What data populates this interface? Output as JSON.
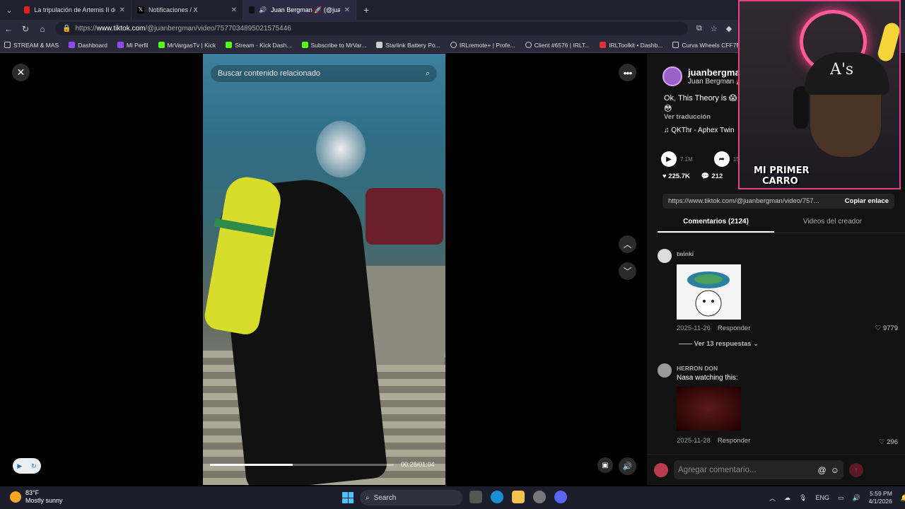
{
  "browser": {
    "tabs": [
      {
        "title": "La tripulación de Artemis II de la N",
        "color": "#e02020"
      },
      {
        "title": "Notificaciones / X",
        "color": "#ffffff"
      },
      {
        "title": "Juan Bergman 🚀 (@juanberg",
        "color": "#ffffff"
      }
    ],
    "url_prefix": "https://",
    "url_host": "www.tiktok.com",
    "url_path": "/@juanbergman/video/7577034895021575446",
    "bookmarks": [
      {
        "label": "STREAM & MAS",
        "color": "#cccccc"
      },
      {
        "label": "Dashboard",
        "color": "#9146ff"
      },
      {
        "label": "Mi Perfil",
        "color": "#9146ff"
      },
      {
        "label": "MrVargasTv | Kick",
        "color": "#53fc18"
      },
      {
        "label": "Stream - Kick Dash...",
        "color": "#53fc18"
      },
      {
        "label": "Subscribe to MrVar...",
        "color": "#53fc18"
      },
      {
        "label": "Starlink Battery Po...",
        "color": "#cccccc"
      },
      {
        "label": "IRLremote+ | Profe...",
        "color": "#cccccc"
      },
      {
        "label": "Client #6576 | IRLT...",
        "color": "#cccccc"
      },
      {
        "label": "IRLToolkit • Dashb...",
        "color": "#e0303a"
      },
      {
        "label": "Curva Wheels CFF7E",
        "color": "#cccccc"
      }
    ]
  },
  "video": {
    "search_placeholder": "Buscar contenido relacionado",
    "progress": 0.45,
    "timecode": "00:28/01:04"
  },
  "panel": {
    "author_handle": "juanbergma",
    "author_name": "Juan Bergman 🚀",
    "description": "Ok, This Theory is 😱 😳 😳",
    "translate": "Ver traducción",
    "music": "♫  QKThr - Aphex Twin",
    "plays": "7.1M",
    "shares": "15.6K",
    "likes": "225.7K",
    "comments_count": "212",
    "link": "https://www.tiktok.com/@juanbergman/video/757...",
    "copy_label": "Copiar enlace",
    "tab_comments": "Comentarios (2124)",
    "tab_videos": "Videos del creador",
    "comments": [
      {
        "user": "twinki",
        "text": "",
        "date": "2025-11-26",
        "reply": "Responder",
        "likes": "9779"
      },
      {
        "user": "HERRON DON",
        "text": "Nasa watching this:",
        "date": "2025-11-28",
        "reply": "Responder",
        "likes": "296"
      }
    ],
    "view_replies": "Ver 13 respuestas",
    "comment_placeholder": "Agregar comentario..."
  },
  "webcam": {
    "overlay_line1": "MI PRIMER",
    "overlay_line2": "CARRO"
  },
  "taskbar": {
    "temp": "83°F",
    "weather": "Mostly sunny",
    "search": "Search",
    "lang": "ENG",
    "time": "5:59 PM",
    "date": "4/1/2026"
  }
}
